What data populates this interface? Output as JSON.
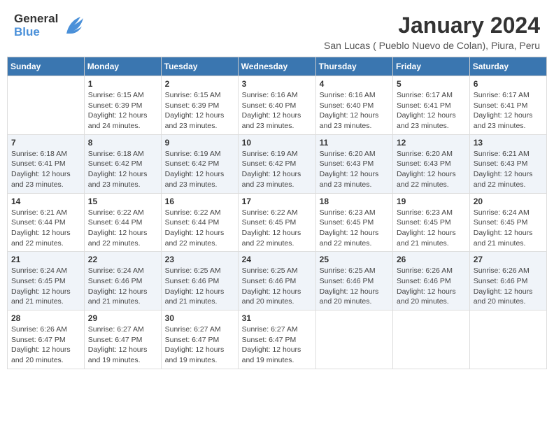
{
  "logo": {
    "general": "General",
    "blue": "Blue"
  },
  "title": "January 2024",
  "subtitle": "San Lucas ( Pueblo Nuevo de Colan), Piura, Peru",
  "headers": [
    "Sunday",
    "Monday",
    "Tuesday",
    "Wednesday",
    "Thursday",
    "Friday",
    "Saturday"
  ],
  "weeks": [
    [
      {
        "day": "",
        "detail": ""
      },
      {
        "day": "1",
        "detail": "Sunrise: 6:15 AM\nSunset: 6:39 PM\nDaylight: 12 hours\nand 24 minutes."
      },
      {
        "day": "2",
        "detail": "Sunrise: 6:15 AM\nSunset: 6:39 PM\nDaylight: 12 hours\nand 23 minutes."
      },
      {
        "day": "3",
        "detail": "Sunrise: 6:16 AM\nSunset: 6:40 PM\nDaylight: 12 hours\nand 23 minutes."
      },
      {
        "day": "4",
        "detail": "Sunrise: 6:16 AM\nSunset: 6:40 PM\nDaylight: 12 hours\nand 23 minutes."
      },
      {
        "day": "5",
        "detail": "Sunrise: 6:17 AM\nSunset: 6:41 PM\nDaylight: 12 hours\nand 23 minutes."
      },
      {
        "day": "6",
        "detail": "Sunrise: 6:17 AM\nSunset: 6:41 PM\nDaylight: 12 hours\nand 23 minutes."
      }
    ],
    [
      {
        "day": "7",
        "detail": "Sunrise: 6:18 AM\nSunset: 6:41 PM\nDaylight: 12 hours\nand 23 minutes."
      },
      {
        "day": "8",
        "detail": "Sunrise: 6:18 AM\nSunset: 6:42 PM\nDaylight: 12 hours\nand 23 minutes."
      },
      {
        "day": "9",
        "detail": "Sunrise: 6:19 AM\nSunset: 6:42 PM\nDaylight: 12 hours\nand 23 minutes."
      },
      {
        "day": "10",
        "detail": "Sunrise: 6:19 AM\nSunset: 6:42 PM\nDaylight: 12 hours\nand 23 minutes."
      },
      {
        "day": "11",
        "detail": "Sunrise: 6:20 AM\nSunset: 6:43 PM\nDaylight: 12 hours\nand 23 minutes."
      },
      {
        "day": "12",
        "detail": "Sunrise: 6:20 AM\nSunset: 6:43 PM\nDaylight: 12 hours\nand 22 minutes."
      },
      {
        "day": "13",
        "detail": "Sunrise: 6:21 AM\nSunset: 6:43 PM\nDaylight: 12 hours\nand 22 minutes."
      }
    ],
    [
      {
        "day": "14",
        "detail": "Sunrise: 6:21 AM\nSunset: 6:44 PM\nDaylight: 12 hours\nand 22 minutes."
      },
      {
        "day": "15",
        "detail": "Sunrise: 6:22 AM\nSunset: 6:44 PM\nDaylight: 12 hours\nand 22 minutes."
      },
      {
        "day": "16",
        "detail": "Sunrise: 6:22 AM\nSunset: 6:44 PM\nDaylight: 12 hours\nand 22 minutes."
      },
      {
        "day": "17",
        "detail": "Sunrise: 6:22 AM\nSunset: 6:45 PM\nDaylight: 12 hours\nand 22 minutes."
      },
      {
        "day": "18",
        "detail": "Sunrise: 6:23 AM\nSunset: 6:45 PM\nDaylight: 12 hours\nand 22 minutes."
      },
      {
        "day": "19",
        "detail": "Sunrise: 6:23 AM\nSunset: 6:45 PM\nDaylight: 12 hours\nand 21 minutes."
      },
      {
        "day": "20",
        "detail": "Sunrise: 6:24 AM\nSunset: 6:45 PM\nDaylight: 12 hours\nand 21 minutes."
      }
    ],
    [
      {
        "day": "21",
        "detail": "Sunrise: 6:24 AM\nSunset: 6:45 PM\nDaylight: 12 hours\nand 21 minutes."
      },
      {
        "day": "22",
        "detail": "Sunrise: 6:24 AM\nSunset: 6:46 PM\nDaylight: 12 hours\nand 21 minutes."
      },
      {
        "day": "23",
        "detail": "Sunrise: 6:25 AM\nSunset: 6:46 PM\nDaylight: 12 hours\nand 21 minutes."
      },
      {
        "day": "24",
        "detail": "Sunrise: 6:25 AM\nSunset: 6:46 PM\nDaylight: 12 hours\nand 20 minutes."
      },
      {
        "day": "25",
        "detail": "Sunrise: 6:25 AM\nSunset: 6:46 PM\nDaylight: 12 hours\nand 20 minutes."
      },
      {
        "day": "26",
        "detail": "Sunrise: 6:26 AM\nSunset: 6:46 PM\nDaylight: 12 hours\nand 20 minutes."
      },
      {
        "day": "27",
        "detail": "Sunrise: 6:26 AM\nSunset: 6:46 PM\nDaylight: 12 hours\nand 20 minutes."
      }
    ],
    [
      {
        "day": "28",
        "detail": "Sunrise: 6:26 AM\nSunset: 6:47 PM\nDaylight: 12 hours\nand 20 minutes."
      },
      {
        "day": "29",
        "detail": "Sunrise: 6:27 AM\nSunset: 6:47 PM\nDaylight: 12 hours\nand 19 minutes."
      },
      {
        "day": "30",
        "detail": "Sunrise: 6:27 AM\nSunset: 6:47 PM\nDaylight: 12 hours\nand 19 minutes."
      },
      {
        "day": "31",
        "detail": "Sunrise: 6:27 AM\nSunset: 6:47 PM\nDaylight: 12 hours\nand 19 minutes."
      },
      {
        "day": "",
        "detail": ""
      },
      {
        "day": "",
        "detail": ""
      },
      {
        "day": "",
        "detail": ""
      }
    ]
  ]
}
